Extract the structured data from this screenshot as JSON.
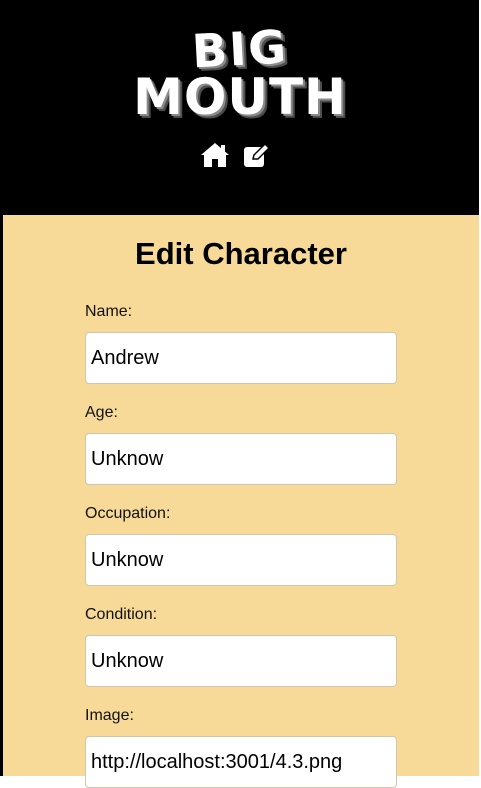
{
  "header": {
    "logo_line1": "BIG",
    "logo_line2": "MOUTH",
    "nav": [
      {
        "icon": "home-icon"
      },
      {
        "icon": "edit-icon"
      }
    ]
  },
  "form": {
    "title": "Edit Character",
    "fields": [
      {
        "label": "Name:",
        "value": "Andrew"
      },
      {
        "label": "Age:",
        "value": "Unknow"
      },
      {
        "label": "Occupation:",
        "value": "Unknow"
      },
      {
        "label": "Condition:",
        "value": "Unknow"
      },
      {
        "label": "Image:",
        "value": "http://localhost:3001/4.3.png"
      }
    ]
  },
  "colors": {
    "header_bg": "#000000",
    "content_bg": "#f7d998",
    "input_bg": "#ffffff"
  }
}
